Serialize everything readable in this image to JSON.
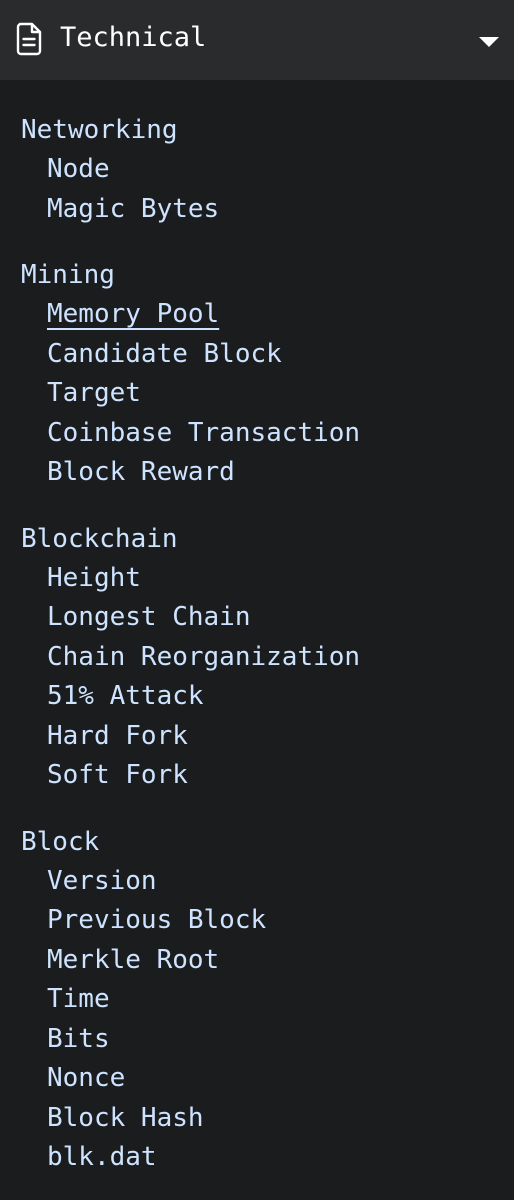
{
  "header": {
    "title": "Technical"
  },
  "colors": {
    "background": "#1b1c1e",
    "header_background": "#2a2b2d",
    "link": "#cde3ff",
    "header_text": "#ffffff"
  },
  "icons": {
    "header_icon": "document-icon",
    "toggle_icon": "caret-down-icon"
  },
  "groups": [
    {
      "heading": "Networking",
      "items": [
        "Node",
        "Magic Bytes"
      ]
    },
    {
      "heading": "Mining",
      "items": [
        "Memory Pool",
        "Candidate Block",
        "Target",
        "Coinbase Transaction",
        "Block Reward"
      ],
      "active_item": "Memory Pool"
    },
    {
      "heading": "Blockchain",
      "items": [
        "Height",
        "Longest Chain",
        "Chain Reorganization",
        "51% Attack",
        "Hard Fork",
        "Soft Fork"
      ]
    },
    {
      "heading": "Block",
      "items": [
        "Version",
        "Previous Block",
        "Merkle Root",
        "Time",
        "Bits",
        "Nonce",
        "Block Hash",
        "blk.dat"
      ]
    }
  ]
}
